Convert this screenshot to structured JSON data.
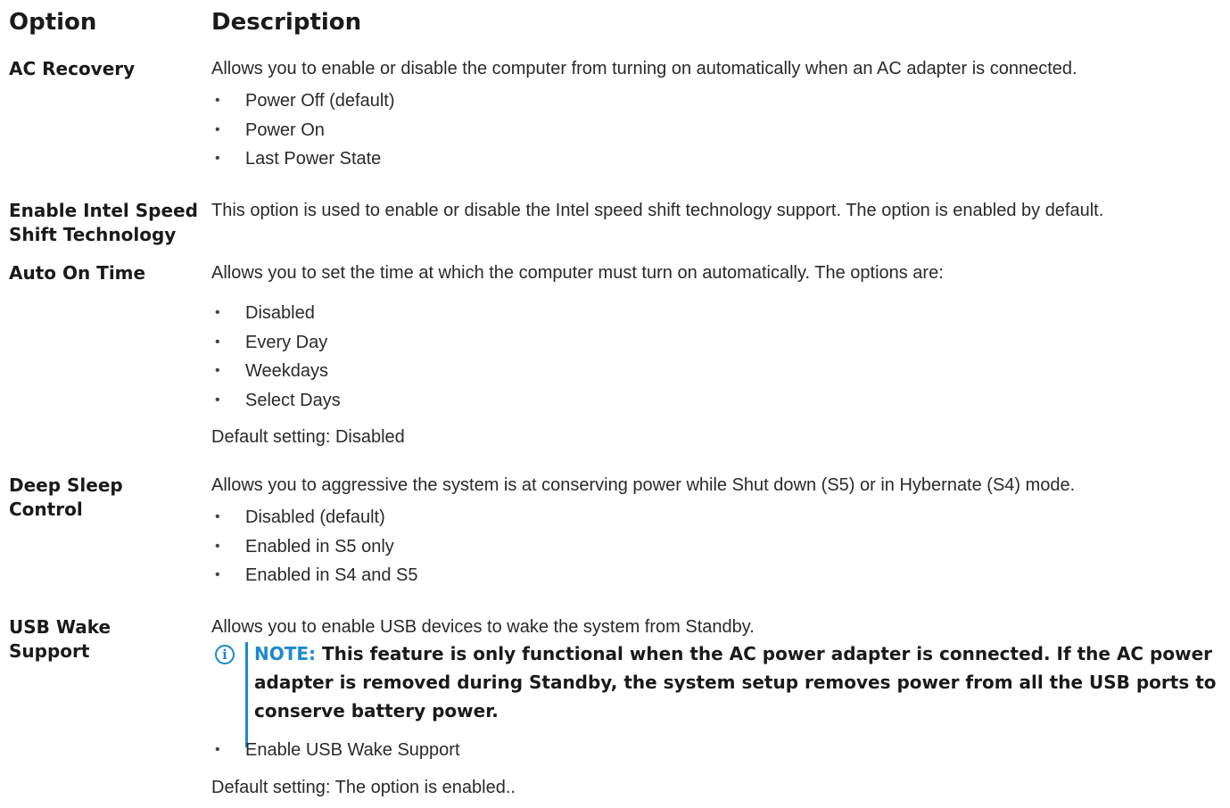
{
  "header": {
    "option": "Option",
    "description": "Description"
  },
  "rows": [
    {
      "option": "AC Recovery",
      "description": "Allows you to enable or disable the computer from turning on automatically when an AC adapter is connected.",
      "items": [
        "Power Off (default)",
        "Power On",
        "Last Power State"
      ]
    },
    {
      "option_line1": "Enable Intel Speed",
      "option_line2": "Shift Technology",
      "description": "This option is used to enable or disable the Intel speed shift technology support. The option is enabled by default."
    },
    {
      "option": "Auto On Time",
      "description": "Allows you to set the time at which the computer must turn on automatically. The options are:",
      "items": [
        "Disabled",
        "Every Day",
        "Weekdays",
        "Select Days"
      ],
      "default": "Default setting: Disabled"
    },
    {
      "option_line1": "Deep Sleep",
      "option_line2": "Control",
      "description": "Allows you to aggressive the system is at conserving power while Shut down (S5) or in Hybernate (S4) mode.",
      "items": [
        "Disabled (default)",
        "Enabled in S5 only",
        "Enabled in S4 and S5"
      ]
    },
    {
      "option_line1": "USB Wake",
      "option_line2": "Support",
      "description": "Allows you to enable USB devices to wake the system from Standby.",
      "note_label": "NOTE:",
      "note_line1": " This feature is only functional when the AC power adapter is connected. If the AC power",
      "note_line2": "adapter is removed during Standby, the system setup removes power from all the USB ports to",
      "note_line3": "conserve battery power.",
      "items": [
        "Enable USB Wake Support"
      ],
      "default": "Default setting: The option is enabled.."
    }
  ],
  "bullet": "•",
  "note_icon": "info-icon",
  "note_icon_glyph": "i",
  "colors": {
    "accent": "#1e88d0",
    "text": "#2a2a2a"
  }
}
